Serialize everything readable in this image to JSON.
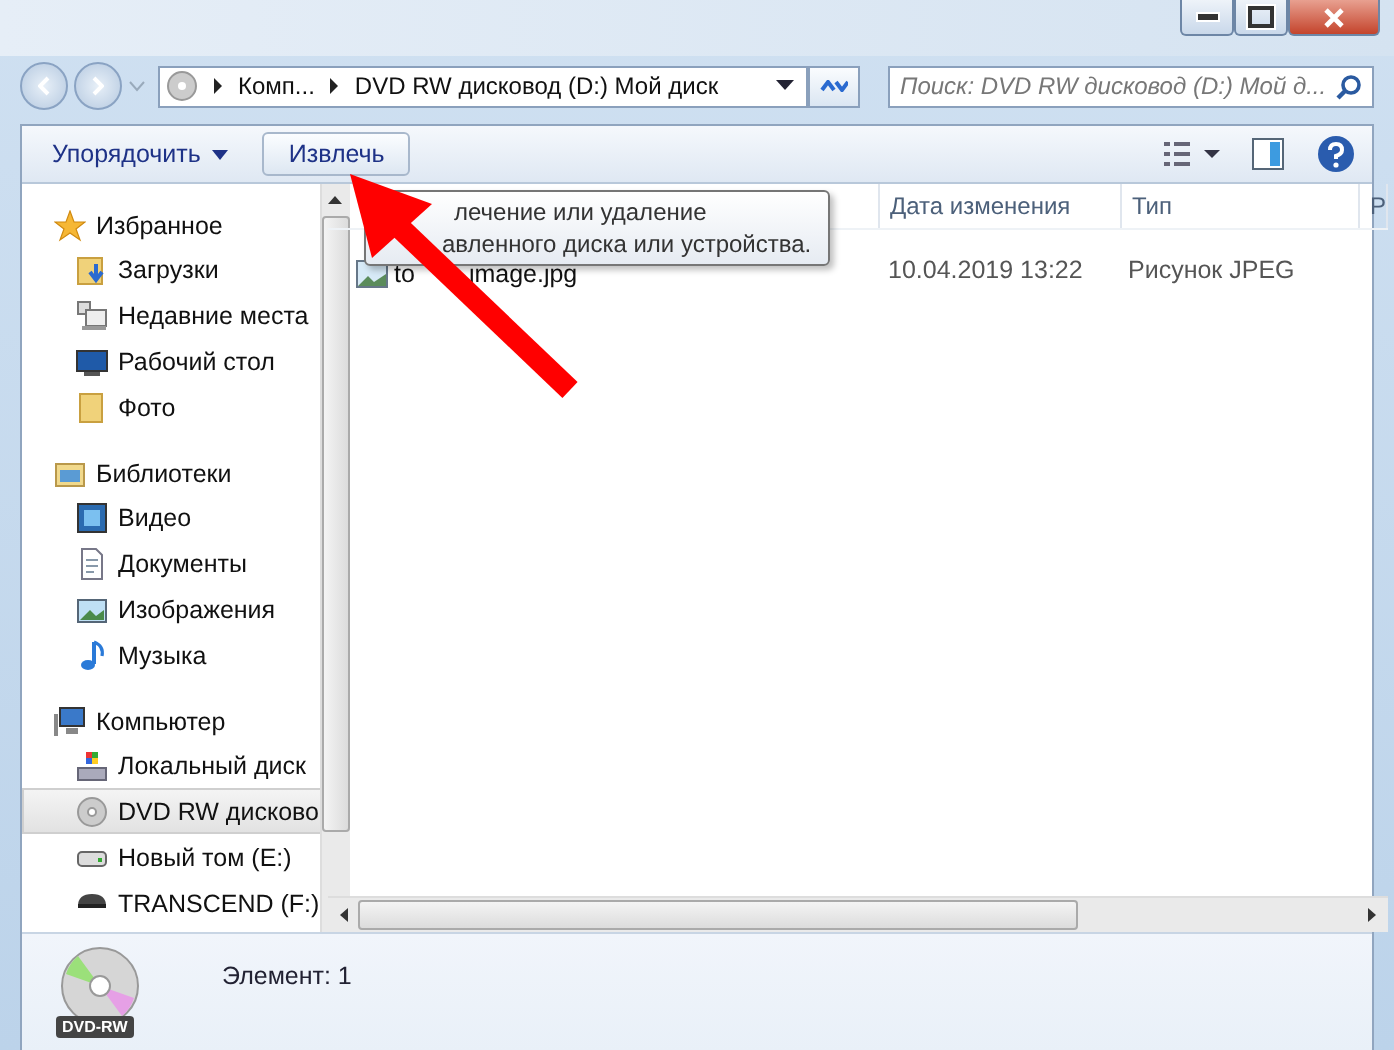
{
  "address": {
    "crumbs": [
      "Комп...",
      "DVD RW дисковод (D:) Мой диск"
    ]
  },
  "search": {
    "placeholder": "Поиск: DVD RW дисковод (D:) Мой д..."
  },
  "toolbar": {
    "organize": "Упорядочить",
    "eject": "Извлечь"
  },
  "sidebar": {
    "groups": [
      {
        "label": "Избранное",
        "children": [
          {
            "label": "Загрузки",
            "selected": false
          },
          {
            "label": "Недавние места",
            "selected": false
          },
          {
            "label": "Рабочий стол",
            "selected": false
          },
          {
            "label": "Фото",
            "selected": false
          }
        ]
      },
      {
        "label": "Библиотеки",
        "children": [
          {
            "label": "Видео",
            "selected": false
          },
          {
            "label": "Документы",
            "selected": false
          },
          {
            "label": "Изображения",
            "selected": false
          },
          {
            "label": "Музыка",
            "selected": false
          }
        ]
      },
      {
        "label": "Компьютер",
        "children": [
          {
            "label": "Локальный диск",
            "selected": false
          },
          {
            "label": "DVD RW дисково",
            "selected": true
          },
          {
            "label": "Новый том (E:)",
            "selected": false
          },
          {
            "label": "TRANSCEND (F:)",
            "selected": false
          }
        ]
      }
    ]
  },
  "table": {
    "columns": [
      "Дата изменения",
      "Тип",
      "Р"
    ],
    "rows": [
      {
        "name_parts": [
          "to",
          "image.jpg"
        ],
        "date": "10.04.2019 13:22",
        "type": "Рисунок JPEG"
      }
    ]
  },
  "tooltip": {
    "lines": [
      "лечение или удаление",
      "авленного диска или устройства."
    ]
  },
  "status_bar": {
    "text": "Элемент: 1",
    "drive_label": "DVD-RW"
  }
}
